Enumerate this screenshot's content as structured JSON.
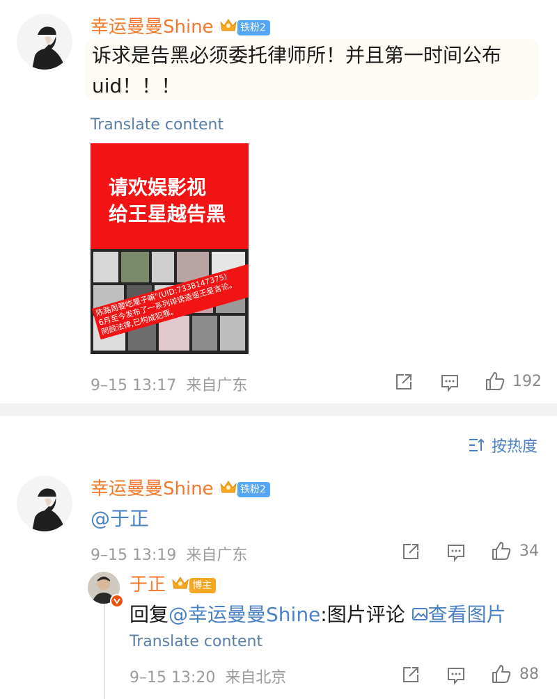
{
  "comment1": {
    "username": "幸运曼曼Shine",
    "badge": "铁粉2",
    "text": "诉求是告黑必须委托律师所！并且第一时间公布uid！！！",
    "translate": "Translate content",
    "image": {
      "headline_line1": "请欢娱影视",
      "headline_line2": "给王星越告黑",
      "overlay_line1": "陈路周要吃厘子嘛\"(UID:7338147375)",
      "overlay_line2": "6月至今发布了一系列诽谤造谣王星言论。",
      "overlay_line3": "罔顾法律,已构成犯罪。"
    },
    "time": "9–15 13:17",
    "location": "来自广东",
    "likes": "192"
  },
  "sort": {
    "label": "按热度"
  },
  "comment2": {
    "username": "幸运曼曼Shine",
    "badge": "铁粉2",
    "text": "@于正",
    "time": "9–15 13:19",
    "location": "来自广东",
    "likes": "34"
  },
  "reply": {
    "username": "于正",
    "badge": "博主",
    "text_prefix": "回复",
    "mention": "@幸运曼曼Shine",
    "text_suffix": ":图片评论",
    "view_image": "查看图片",
    "translate": "Translate content",
    "time": "9–15 13:20",
    "location": "来自北京",
    "likes": "88"
  },
  "colors": {
    "accent_orange": "#f5782a",
    "link_blue": "#4b82c5",
    "image_red": "#f21414"
  }
}
